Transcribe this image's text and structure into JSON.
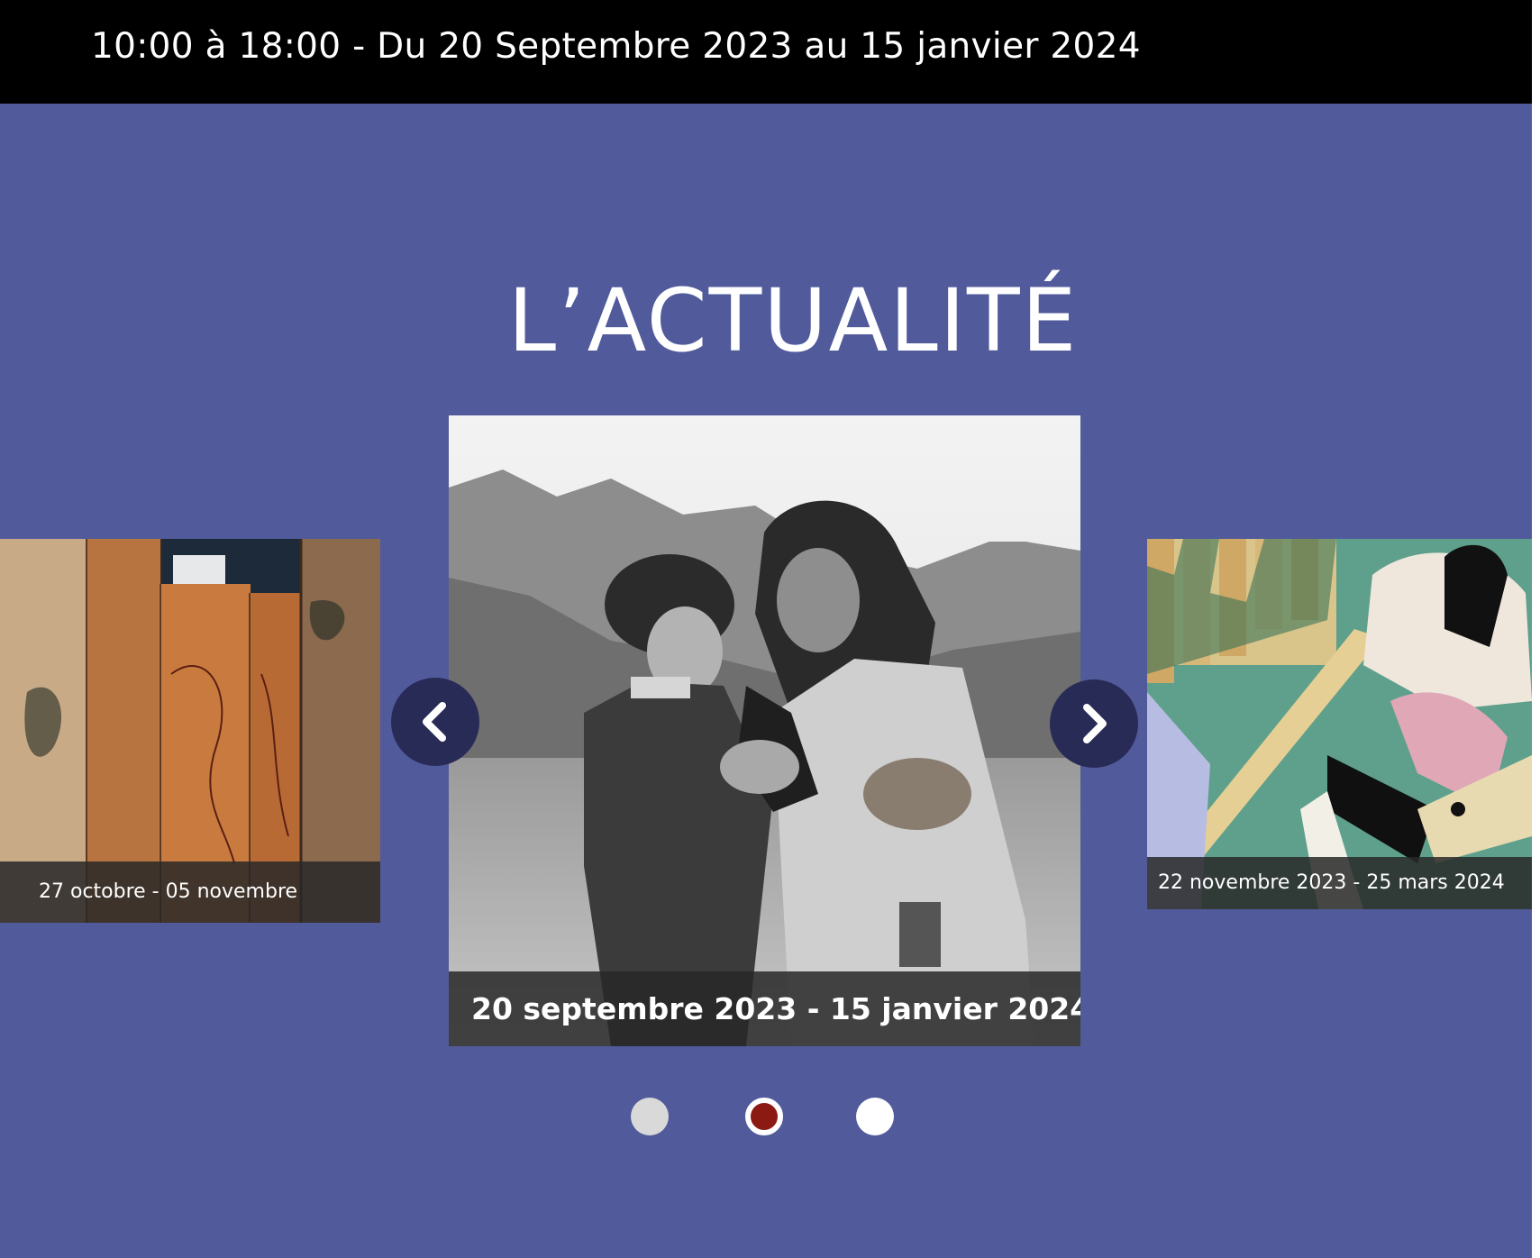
{
  "header": {
    "hours_and_dates": "10:00 à 18:00 - Du 20 Septembre 2023 au 15 janvier 2024"
  },
  "news": {
    "title": "L’ACTUALITÉ",
    "slides": [
      {
        "caption": "27 octobre - 05 novembre",
        "image": "folding-screens-artwork"
      },
      {
        "caption": "20 septembre 2023 - 15 janvier 2024",
        "image": "black-and-white-film-still"
      },
      {
        "caption": "22 novembre 2023 - 25 mars 2024",
        "image": "japanese-painting-scene"
      }
    ],
    "controls": {
      "prev_icon": "chevron-left-icon",
      "next_icon": "chevron-right-icon"
    },
    "pagination": {
      "count": 3,
      "active_index": 1
    }
  },
  "colors": {
    "background": "#515a9b",
    "top_bar": "#000000",
    "nav_button": "#282b55",
    "active_dot": "#8b1a12",
    "caption_bg": "#282828"
  }
}
